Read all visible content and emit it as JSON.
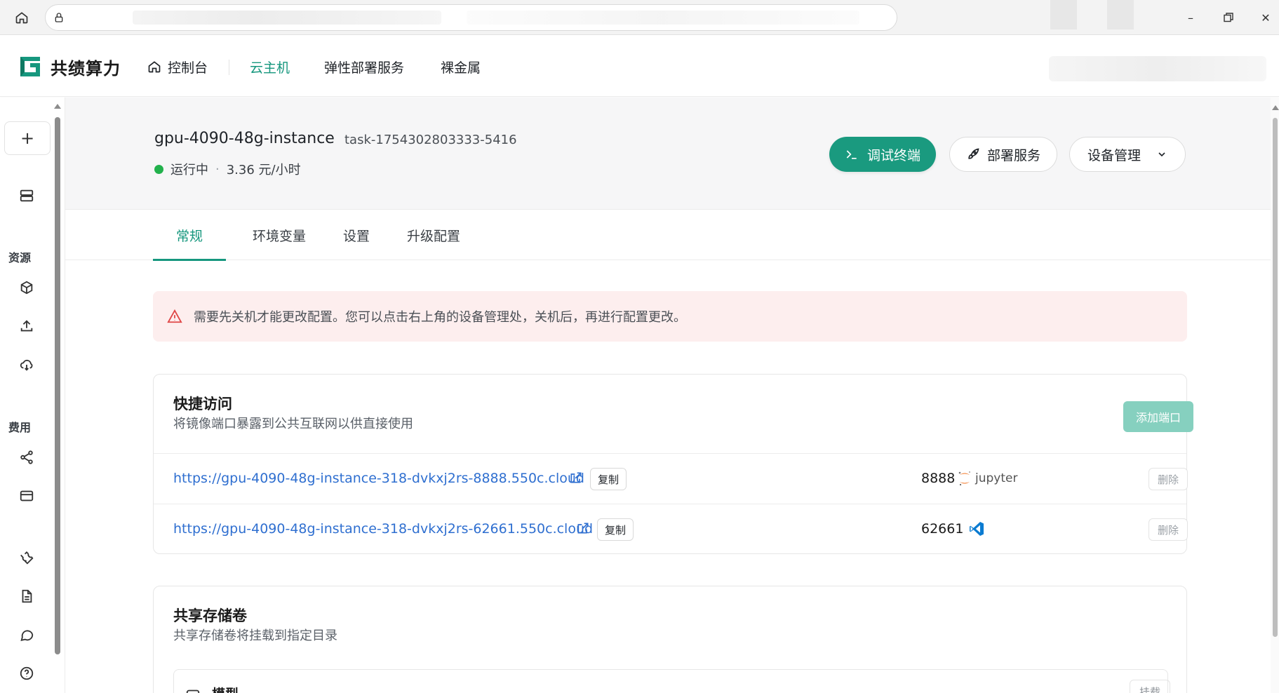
{
  "nav": {
    "brand": "共绩算力",
    "items": [
      {
        "label": "控制台",
        "icon": "home-icon"
      },
      {
        "label": "云主机",
        "active": true
      },
      {
        "label": "弹性部署服务"
      },
      {
        "label": "裸金属"
      }
    ]
  },
  "sidebar": {
    "new_button": "+",
    "section_resources": "资源",
    "section_billing": "费用",
    "icons": [
      "server-icon",
      "cube-icon",
      "upload-icon",
      "cloud-sync-icon",
      "share-icon",
      "card-icon",
      "wrench-icon",
      "document-icon",
      "chat-icon",
      "help-icon"
    ]
  },
  "instance": {
    "name": "gpu-4090-48g-instance",
    "task_id": "task-1754302803333-5416",
    "status": "运行中",
    "separator": "·",
    "price": "3.36 元/小时",
    "status_color": "#22b14c"
  },
  "actions": {
    "terminal": "调试终端",
    "deploy": "部署服务",
    "device": "设备管理"
  },
  "tabs": [
    {
      "label": "常规",
      "active": true
    },
    {
      "label": "环境变量"
    },
    {
      "label": "设置"
    },
    {
      "label": "升级配置"
    }
  ],
  "alert": {
    "text": "需要先关机才能更改配置。您可以点击右上角的设备管理处，关机后，再进行配置更改。"
  },
  "quick_access": {
    "title": "快捷访问",
    "subtitle": "将镜像端口暴露到公共互联网以供直接使用",
    "add_port": "添加端口",
    "ports": [
      {
        "url": "https://gpu-4090-48g-instance-318-dvkxj2rs-8888.550c.cloud",
        "copy": "复制",
        "port": "8888",
        "service": "jupyter",
        "delete": "删除"
      },
      {
        "url": "https://gpu-4090-48g-instance-318-dvkxj2rs-62661.550c.cloud",
        "copy": "复制",
        "port": "62661",
        "service": "vscode",
        "delete": "删除"
      }
    ]
  },
  "shared_storage": {
    "title": "共享存储卷",
    "subtitle": "共享存储卷将挂载到指定目录",
    "volume_name": "模型",
    "mount_label": "挂载"
  },
  "colors": {
    "accent": "#16977e",
    "primary_button": "#1a9a7f",
    "link": "#2f6fd0",
    "alert_bg": "#fdeeee",
    "alert_icon": "#e04848"
  }
}
